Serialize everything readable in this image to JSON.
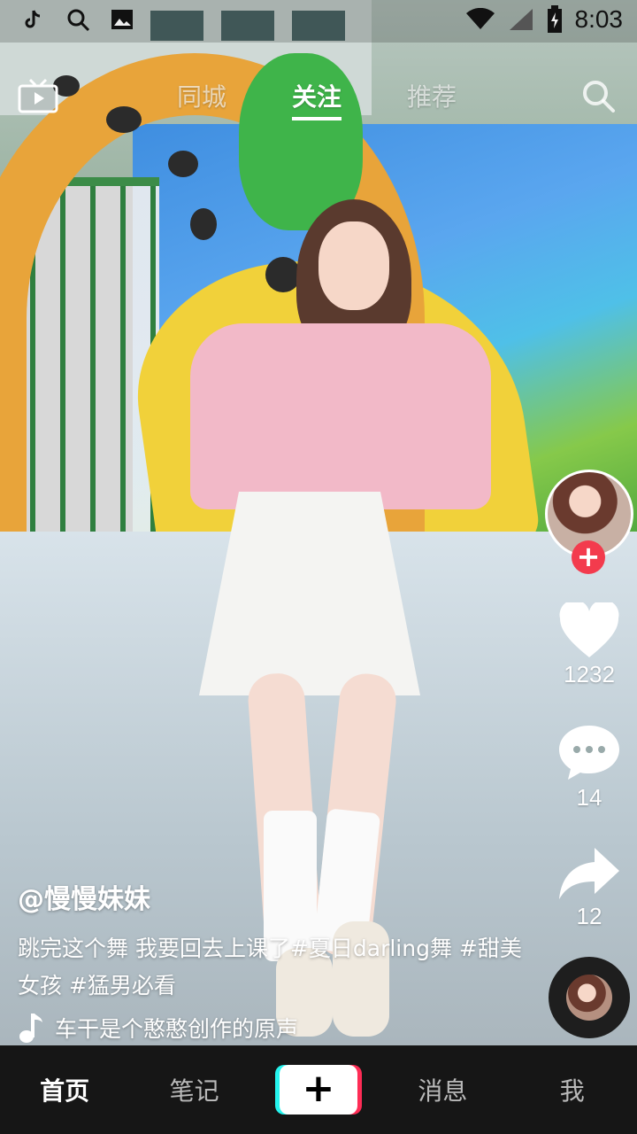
{
  "status_bar": {
    "time": "8:03",
    "left_icons": [
      "tiktok-icon",
      "search-icon",
      "image-icon"
    ],
    "right_icons": [
      "wifi-icon",
      "signal-icon",
      "battery-icon"
    ]
  },
  "top_nav": {
    "tabs": [
      {
        "label": "同城",
        "active": false
      },
      {
        "label": "关注",
        "active": true
      },
      {
        "label": "推荐",
        "active": false
      }
    ],
    "left_icon": "tv-icon",
    "right_icon": "search-icon"
  },
  "video": {
    "author": "@慢慢妹妹",
    "description": "跳完这个舞 我要回去上课了#夏日darling舞 #甜美女孩 #猛男必看",
    "music": "车干是个憨憨创作的原声",
    "likes": "1232",
    "comments": "14",
    "shares": "12"
  },
  "bottom_nav": {
    "items": [
      {
        "label": "首页",
        "active": true
      },
      {
        "label": "笔记",
        "active": false
      },
      {
        "label": "+",
        "active": false
      },
      {
        "label": "消息",
        "active": false
      },
      {
        "label": "我",
        "active": false
      }
    ]
  },
  "colors": {
    "accent_red": "#f33b4d",
    "tiktok_cyan": "#25f4ee",
    "tiktok_pink": "#fe2c55",
    "bottom_bar": "#161616"
  }
}
